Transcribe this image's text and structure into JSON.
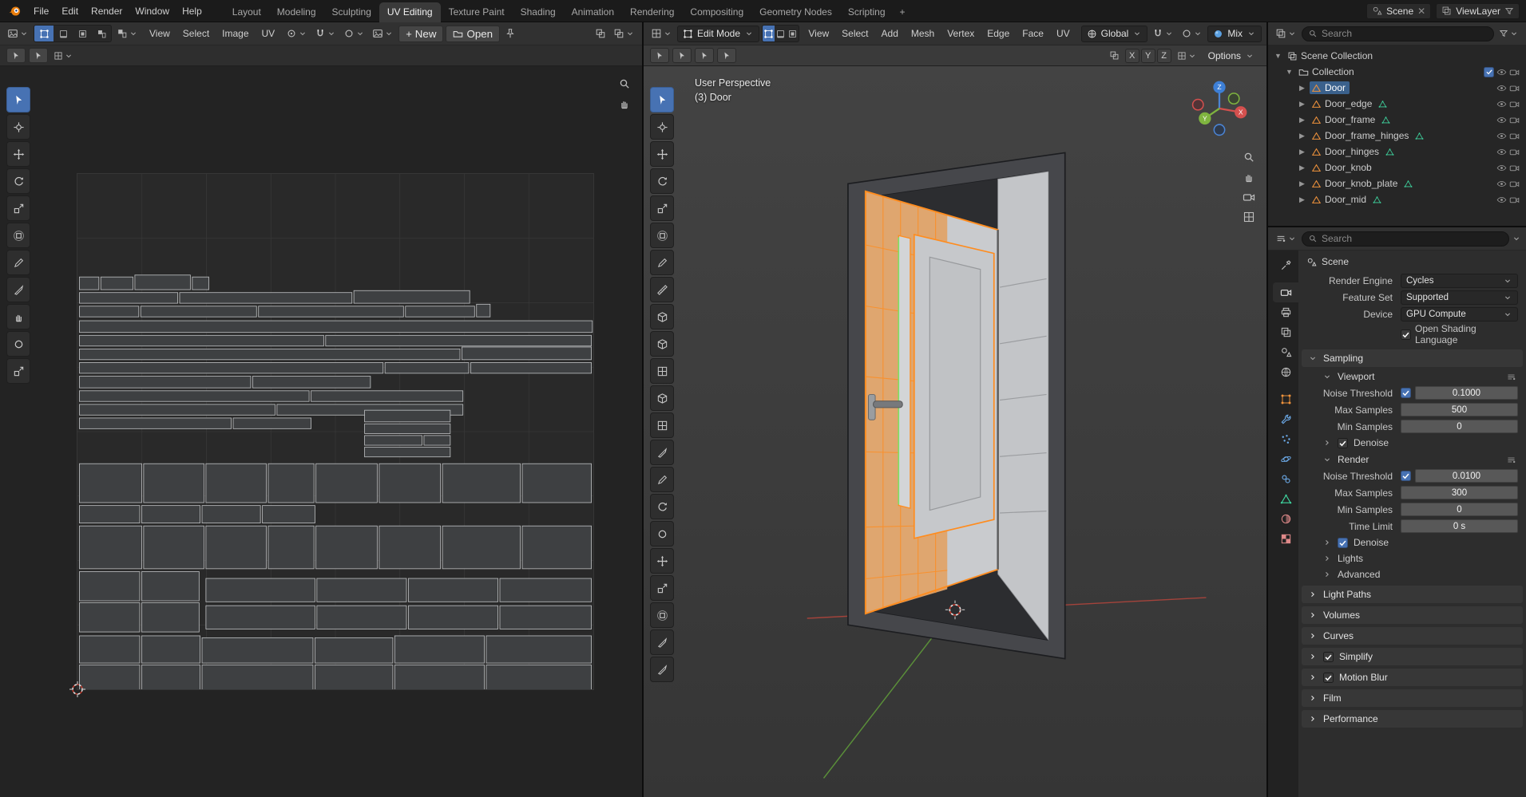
{
  "topbar": {
    "menus": [
      "File",
      "Edit",
      "Render",
      "Window",
      "Help"
    ],
    "workspaces": [
      "Layout",
      "Modeling",
      "Sculpting",
      "UV Editing",
      "Texture Paint",
      "Shading",
      "Animation",
      "Rendering",
      "Compositing",
      "Geometry Nodes",
      "Scripting"
    ],
    "active_workspace": "UV Editing",
    "add_workspace_label": "+",
    "scene_label": "Scene",
    "viewlayer_label": "ViewLayer"
  },
  "uv_editor": {
    "menus": [
      "View",
      "Select",
      "Image",
      "UV"
    ],
    "new_button": "New",
    "open_button": "Open",
    "tools": [
      "select-box",
      "cursor",
      "move",
      "rotate",
      "scale",
      "transform",
      "annotate",
      "rip-region",
      "grab",
      "relax",
      "pinch"
    ],
    "islands": [
      [
        2,
        106,
        20,
        13
      ],
      [
        24,
        106,
        33,
        13
      ],
      [
        59,
        104,
        57,
        15
      ],
      [
        118,
        106,
        17,
        13
      ],
      [
        2,
        122,
        101,
        11
      ],
      [
        105,
        122,
        177,
        11
      ],
      [
        284,
        120,
        119,
        13
      ],
      [
        2,
        136,
        61,
        11
      ],
      [
        65,
        136,
        119,
        11
      ],
      [
        186,
        136,
        149,
        11
      ],
      [
        337,
        136,
        71,
        11
      ],
      [
        410,
        134,
        14,
        13
      ],
      [
        2,
        151,
        527,
        12
      ],
      [
        2,
        166,
        251,
        11
      ],
      [
        255,
        166,
        273,
        11
      ],
      [
        2,
        180,
        391,
        11
      ],
      [
        395,
        178,
        133,
        13
      ],
      [
        2,
        194,
        312,
        11
      ],
      [
        316,
        194,
        86,
        11
      ],
      [
        404,
        194,
        124,
        11
      ],
      [
        2,
        208,
        176,
        12
      ],
      [
        180,
        208,
        121,
        12
      ],
      [
        2,
        223,
        236,
        11
      ],
      [
        240,
        223,
        156,
        11
      ],
      [
        2,
        237,
        201,
        11
      ],
      [
        205,
        237,
        191,
        11
      ],
      [
        2,
        251,
        156,
        11
      ],
      [
        160,
        251,
        80,
        11
      ],
      [
        295,
        243,
        88,
        12
      ],
      [
        295,
        257,
        88,
        10
      ],
      [
        295,
        269,
        59,
        10
      ],
      [
        356,
        269,
        27,
        10
      ],
      [
        295,
        281,
        88,
        10
      ],
      [
        2,
        298,
        64,
        40
      ],
      [
        68,
        298,
        62,
        40
      ],
      [
        132,
        298,
        62,
        40
      ],
      [
        196,
        298,
        47,
        40
      ],
      [
        245,
        298,
        63,
        40
      ],
      [
        310,
        298,
        63,
        40
      ],
      [
        375,
        298,
        80,
        40
      ],
      [
        457,
        298,
        71,
        40
      ],
      [
        2,
        341,
        62,
        18
      ],
      [
        66,
        341,
        60,
        18
      ],
      [
        128,
        341,
        60,
        18
      ],
      [
        190,
        341,
        54,
        18
      ],
      [
        2,
        362,
        64,
        44
      ],
      [
        68,
        362,
        62,
        44
      ],
      [
        132,
        362,
        62,
        44
      ],
      [
        196,
        362,
        47,
        44
      ],
      [
        245,
        362,
        63,
        44
      ],
      [
        310,
        362,
        63,
        44
      ],
      [
        375,
        362,
        80,
        44
      ],
      [
        457,
        362,
        71,
        44
      ],
      [
        2,
        409,
        62,
        30
      ],
      [
        66,
        409,
        59,
        30
      ],
      [
        2,
        441,
        62,
        30
      ],
      [
        66,
        441,
        59,
        30
      ],
      [
        132,
        416,
        112,
        24
      ],
      [
        246,
        416,
        92,
        24
      ],
      [
        340,
        416,
        92,
        24
      ],
      [
        434,
        416,
        94,
        24
      ],
      [
        132,
        444,
        112,
        24
      ],
      [
        246,
        444,
        92,
        24
      ],
      [
        340,
        444,
        92,
        24
      ],
      [
        434,
        444,
        94,
        24
      ],
      [
        2,
        475,
        62,
        28
      ],
      [
        66,
        475,
        60,
        28
      ],
      [
        128,
        477,
        114,
        26
      ],
      [
        244,
        477,
        80,
        26
      ],
      [
        326,
        475,
        92,
        28
      ],
      [
        420,
        475,
        108,
        28
      ],
      [
        2,
        505,
        62,
        26
      ],
      [
        66,
        505,
        60,
        26
      ],
      [
        128,
        505,
        114,
        26
      ],
      [
        244,
        505,
        80,
        26
      ],
      [
        326,
        505,
        92,
        26
      ],
      [
        420,
        505,
        108,
        26
      ]
    ]
  },
  "viewport": {
    "mode_label": "Edit Mode",
    "menus": [
      "View",
      "Select",
      "Add",
      "Mesh",
      "Vertex",
      "Edge",
      "Face",
      "UV"
    ],
    "orientation_label": "Global",
    "mix_label": "Mix",
    "options_label": "Options",
    "axis_toggles": [
      "X",
      "Y",
      "Z"
    ],
    "overlay_line1": "User Perspective",
    "overlay_line2": "(3) Door",
    "gizmo": {
      "x": "X",
      "y": "Y",
      "z": "Z"
    },
    "tools": [
      "select-box",
      "cursor",
      "move",
      "rotate",
      "scale",
      "transform",
      "annotate",
      "measure",
      "add-cube",
      "extrude-region",
      "inset-faces",
      "bevel",
      "loop-cut",
      "knife",
      "poly-build",
      "spin",
      "smooth",
      "edge-slide",
      "shrink-flatten",
      "shear",
      "rip-region",
      "rip-edge"
    ]
  },
  "outliner": {
    "search_placeholder": "Search",
    "root_label": "Scene Collection",
    "collection_label": "Collection",
    "collection_checked": true,
    "items": [
      {
        "name": "Door",
        "selected": true,
        "data_icon": false
      },
      {
        "name": "Door_edge",
        "selected": false,
        "data_icon": true
      },
      {
        "name": "Door_frame",
        "selected": false,
        "data_icon": true
      },
      {
        "name": "Door_frame_hinges",
        "selected": false,
        "data_icon": true
      },
      {
        "name": "Door_hinges",
        "selected": false,
        "data_icon": true
      },
      {
        "name": "Door_knob",
        "selected": false,
        "data_icon": false
      },
      {
        "name": "Door_knob_plate",
        "selected": false,
        "data_icon": true
      },
      {
        "name": "Door_mid",
        "selected": false,
        "data_icon": true
      }
    ]
  },
  "properties": {
    "search_placeholder": "Search",
    "breadcrumb": "Scene",
    "tabs": [
      "tool",
      "render",
      "output",
      "view-layer",
      "scene",
      "world",
      "object",
      "modifiers",
      "particles",
      "physics",
      "constraints",
      "object-data",
      "material",
      "texture"
    ],
    "active_tab": "render",
    "render_engine_label": "Render Engine",
    "render_engine": "Cycles",
    "feature_set_label": "Feature Set",
    "feature_set": "Supported",
    "device_label": "Device",
    "device": "GPU Compute",
    "osl_label": "Open Shading Language",
    "osl_checked": false,
    "sampling_title": "Sampling",
    "viewport_panel": {
      "title": "Viewport",
      "noise_threshold_label": "Noise Threshold",
      "noise_threshold_checked": true,
      "noise_threshold": "0.1000",
      "max_samples_label": "Max Samples",
      "max_samples": "500",
      "min_samples_label": "Min Samples",
      "min_samples": "0",
      "denoise_label": "Denoise",
      "denoise_checked": false
    },
    "render_panel": {
      "title": "Render",
      "noise_threshold_label": "Noise Threshold",
      "noise_threshold_checked": true,
      "noise_threshold": "0.0100",
      "max_samples_label": "Max Samples",
      "max_samples": "300",
      "min_samples_label": "Min Samples",
      "min_samples": "0",
      "time_limit_label": "Time Limit",
      "time_limit": "0 s",
      "denoise_label": "Denoise",
      "denoise_checked": true
    },
    "lights_label": "Lights",
    "advanced_label": "Advanced",
    "sections": [
      {
        "label": "Light Paths"
      },
      {
        "label": "Volumes"
      },
      {
        "label": "Curves"
      },
      {
        "label": "Simplify",
        "checkbox": false
      },
      {
        "label": "Motion Blur",
        "checkbox": false
      },
      {
        "label": "Film"
      },
      {
        "label": "Performance"
      }
    ]
  },
  "colors": {
    "accent": "#4772b3",
    "selection_orange": "#ff8c1e",
    "mesh_icon_orange": "#f0933c",
    "data_icon_green": "#3fd6a0",
    "axis_x": "#c4473d",
    "axis_y": "#6faf3c",
    "axis_z": "#3d7fd6"
  }
}
